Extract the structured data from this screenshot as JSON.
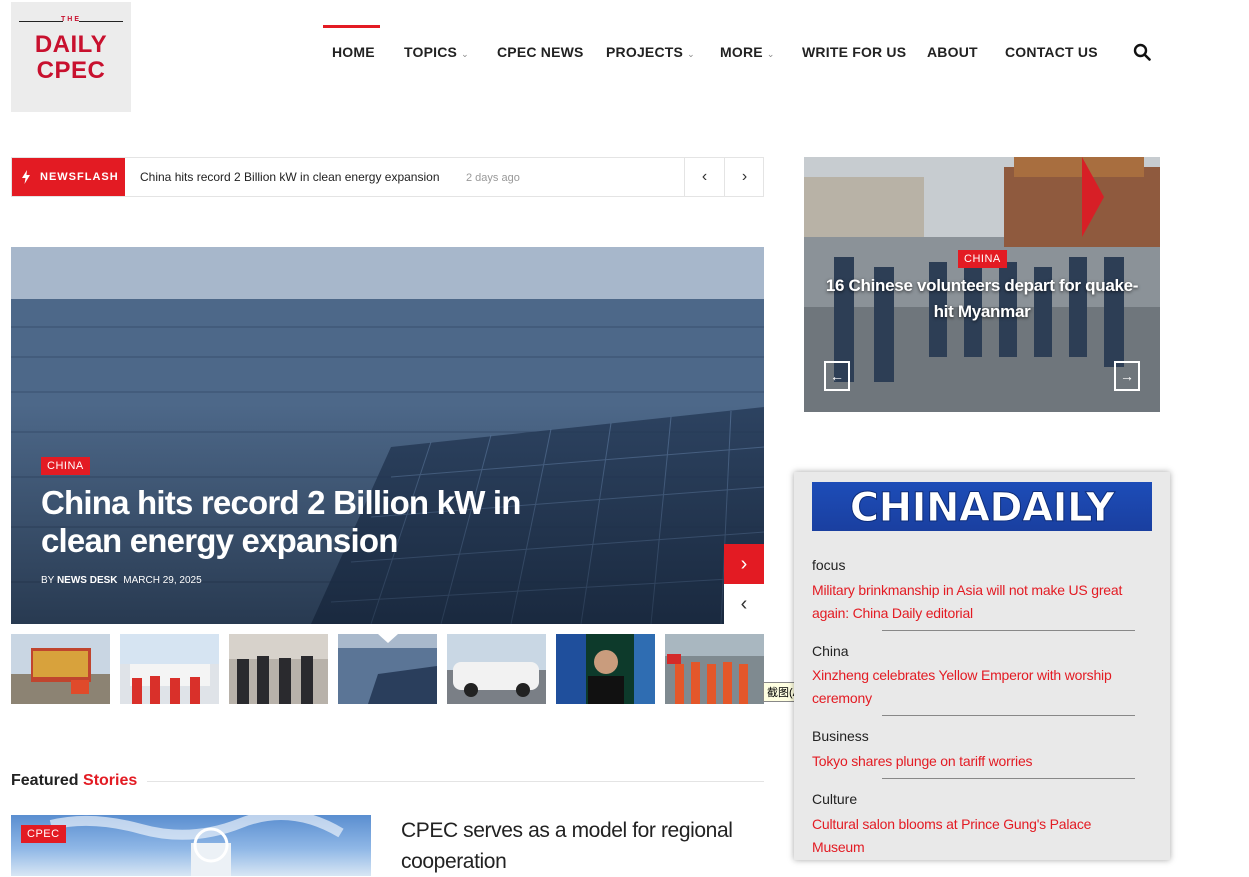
{
  "header": {
    "logo": {
      "the": "THE",
      "line1": "DAILY",
      "line2": "CPEC"
    },
    "nav": [
      {
        "label": "HOME",
        "has_caret": false,
        "active": true
      },
      {
        "label": "TOPICS",
        "has_caret": true
      },
      {
        "label": "CPEC NEWS",
        "has_caret": false
      },
      {
        "label": "PROJECTS",
        "has_caret": true
      },
      {
        "label": "MORE",
        "has_caret": true
      },
      {
        "label": "WRITE FOR US",
        "has_caret": false
      },
      {
        "label": "ABOUT",
        "has_caret": false
      },
      {
        "label": "CONTACT US",
        "has_caret": false
      }
    ],
    "search_icon": "search-icon"
  },
  "newsflash": {
    "label": "NEWSFLASH",
    "headline": "China hits record 2 Billion kW in clean energy expansion",
    "time": "2 days ago",
    "prev_icon": "chevron-left-icon",
    "next_icon": "chevron-right-icon"
  },
  "hero": {
    "category": "CHINA",
    "title": "China hits record 2 Billion kW in clean energy expansion",
    "by": "BY",
    "author": "NEWS DESK",
    "date": "MARCH 29, 2025"
  },
  "thumbnails": [
    "truck-loading",
    "volunteers-banner",
    "officials-meeting",
    "solar-field",
    "white-suv",
    "official-portrait",
    "rescue-team"
  ],
  "tooltip": "截图(Alt + A)",
  "featured": {
    "heading_plain": "Featured",
    "heading_accent": "Stories",
    "item": {
      "category": "CPEC",
      "title": "CPEC serves as a model for regional cooperation"
    }
  },
  "side_slider": {
    "category": "CHINA",
    "title": "16 Chinese volunteers depart for quake-hit Myanmar"
  },
  "china_daily": {
    "logo_text": "CHINADAILY",
    "sections": [
      {
        "category": "focus",
        "headline": "Military brinkmanship in Asia will not make US great again: China Daily editorial"
      },
      {
        "category": "China",
        "headline": "Xinzheng celebrates Yellow Emperor with worship ceremony"
      },
      {
        "category": "Business",
        "headline": "Tokyo shares plunge on tariff worries"
      },
      {
        "category": "Culture",
        "headline": "Cultural salon blooms at Prince Gung's Palace Museum"
      }
    ]
  },
  "colors": {
    "accent": "#e31b23",
    "text": "#222222",
    "widget_bg": "#e9e9e9"
  }
}
